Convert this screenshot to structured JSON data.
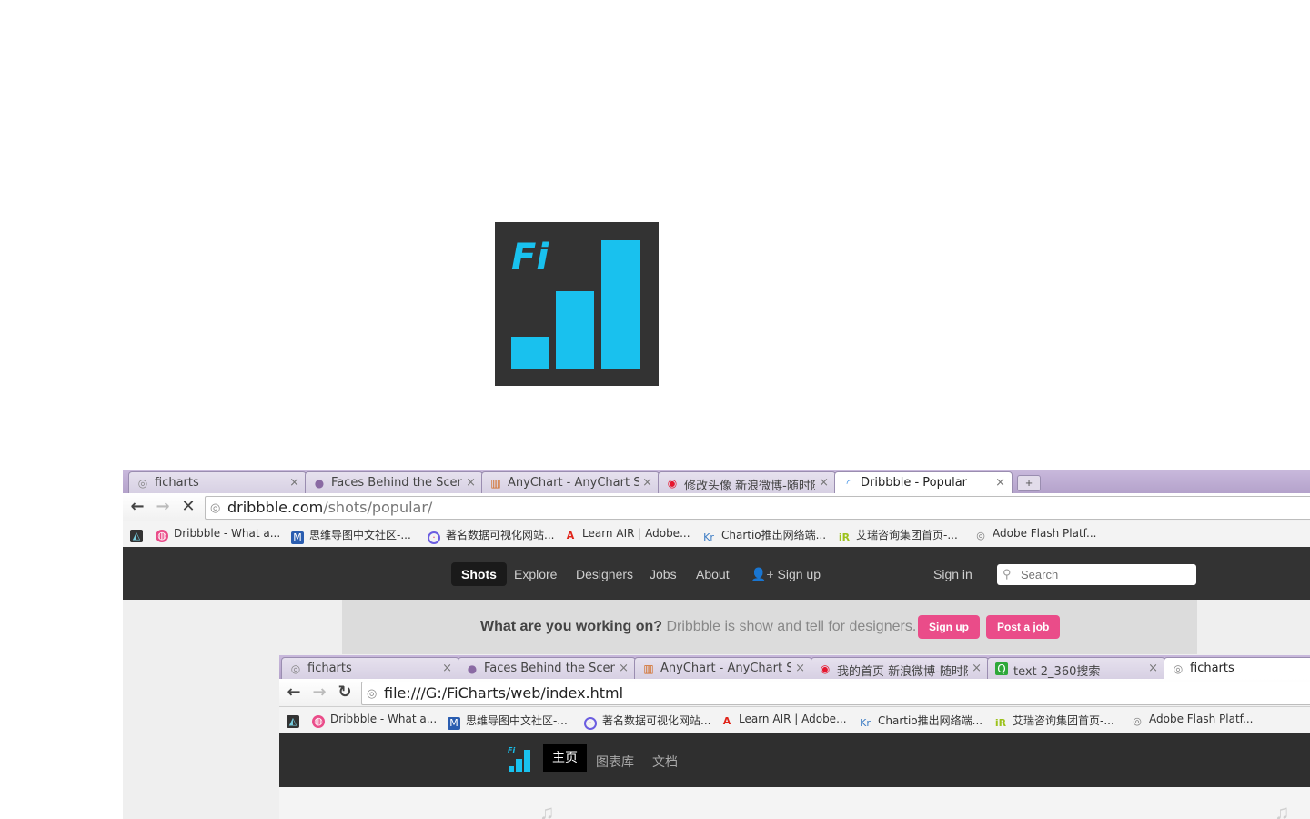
{
  "logo": {
    "text": "Fi",
    "color": "#19c1ee",
    "background": "#333333"
  },
  "browser1": {
    "tabs": [
      {
        "title": "ficharts",
        "icon": "globe-icon"
      },
      {
        "title": "Faces Behind the Scenes",
        "icon": "dribbble-icon"
      },
      {
        "title": "AnyChart - AnyChart Sup",
        "icon": "anychart-icon"
      },
      {
        "title": "修改头像 新浪微博-随时随",
        "icon": "weibo-icon"
      },
      {
        "title": "Dribbble - Popular",
        "icon": "loading-spinner-icon"
      }
    ],
    "url": {
      "host": "dribbble.com",
      "path": "/shots/popular/"
    }
  },
  "bookmarks": [
    {
      "label": "Dribbble - What a...",
      "icon": "dribbble-icon",
      "color": "#ea4c89"
    },
    {
      "label": "思维导图中文社区-...",
      "icon": "mindmap-icon",
      "color": "#2a5db0"
    },
    {
      "label": "著名数据可视化网站...",
      "icon": "dataviz-icon",
      "color": "#6b5de0"
    },
    {
      "label": "Learn AIR | Adobe...",
      "icon": "adobe-icon",
      "color": "#e0251b"
    },
    {
      "label": "Chartio推出网络端...",
      "icon": "kr-icon",
      "color": "#3b7bc4"
    },
    {
      "label": "艾瑞咨询集团首页-...",
      "icon": "iresearch-icon",
      "color": "#9cc21b"
    },
    {
      "label": "Adobe Flash Platf...",
      "icon": "globe-icon",
      "color": "#777777"
    }
  ],
  "dribbble": {
    "nav": [
      "Shots",
      "Explore",
      "Designers",
      "Jobs",
      "About",
      "Sign up"
    ],
    "signin": "Sign in",
    "search_placeholder": "Search",
    "promo_question": "What are you working on?",
    "promo_text": "Dribbble is show and tell for designers.",
    "signup_button": "Sign up",
    "post_job_button": "Post a job",
    "accent": "#ea4c89"
  },
  "browser2": {
    "tabs": [
      {
        "title": "ficharts",
        "icon": "globe-icon"
      },
      {
        "title": "Faces Behind the Scenes",
        "icon": "dribbble-icon"
      },
      {
        "title": "AnyChart - AnyChart Sup",
        "icon": "anychart-icon"
      },
      {
        "title": "我的首页 新浪微博-随时随",
        "icon": "weibo-icon"
      },
      {
        "title": "text 2_360搜索",
        "icon": "search360-icon"
      },
      {
        "title": "ficharts",
        "icon": "globe-icon"
      }
    ],
    "url": "file:///G:/FiCharts/web/index.html"
  },
  "ficharts": {
    "nav": [
      "主页",
      "图表库",
      "文档"
    ]
  }
}
